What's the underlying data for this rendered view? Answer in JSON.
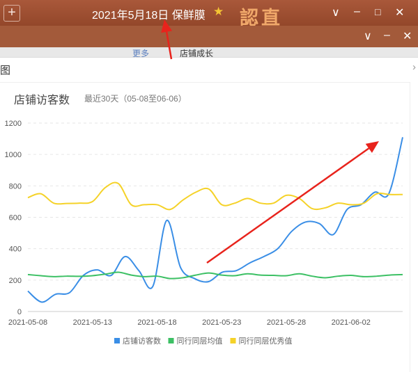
{
  "topbar": {
    "plus": "+",
    "title": "2021年5月18日 保鲜膜",
    "star_icon": "star-icon",
    "stamp_text": "認直",
    "minimize": "–",
    "maximize": "□",
    "close": "✕",
    "dropdown": "∨"
  },
  "secondbar": {
    "dropdown": "∨",
    "minimize": "–",
    "close": "✕"
  },
  "tabs": [
    "更多",
    "店铺成长"
  ],
  "dialog": {
    "title": "图",
    "close": "›"
  },
  "chart_data": {
    "type": "line",
    "title": "店铺访客数",
    "subtitle": "最近30天（05-08至06-06）",
    "xlabel": "",
    "ylabel": "",
    "ylim": [
      0,
      1200
    ],
    "yticks": [
      0,
      200,
      400,
      600,
      800,
      1000,
      1200
    ],
    "x": [
      "2021-05-08",
      "2021-05-09",
      "2021-05-10",
      "2021-05-11",
      "2021-05-12",
      "2021-05-13",
      "2021-05-14",
      "2021-05-15",
      "2021-05-16",
      "2021-05-17",
      "2021-05-18",
      "2021-05-19",
      "2021-05-20",
      "2021-05-21",
      "2021-05-22",
      "2021-05-23",
      "2021-05-24",
      "2021-05-25",
      "2021-05-26",
      "2021-05-27",
      "2021-05-28",
      "2021-05-29",
      "2021-05-30",
      "2021-05-31",
      "2021-06-01",
      "2021-06-02",
      "2021-06-03",
      "2021-06-04",
      "2021-06-05",
      "2021-06-06"
    ],
    "xtick_labels": [
      "2021-05-08",
      "2021-05-13",
      "2021-05-18",
      "2021-05-23",
      "2021-05-28",
      "2021-06-02"
    ],
    "grid": true,
    "legend_position": "bottom",
    "series": [
      {
        "name": "店铺访客数",
        "color": "#3a8ee6",
        "values": [
          130,
          60,
          110,
          120,
          230,
          265,
          230,
          350,
          260,
          160,
          580,
          280,
          210,
          190,
          250,
          260,
          310,
          350,
          400,
          510,
          570,
          560,
          490,
          650,
          680,
          760,
          750,
          1110
        ]
      },
      {
        "name": "同行同层均值",
        "color": "#3cc064",
        "values": [
          235,
          228,
          222,
          225,
          224,
          228,
          238,
          250,
          232,
          222,
          225,
          210,
          215,
          232,
          245,
          232,
          228,
          240,
          232,
          230,
          228,
          240,
          225,
          215,
          225,
          230,
          222,
          225,
          232,
          235
        ]
      },
      {
        "name": "同行同层优秀值",
        "color": "#f5d228",
        "values": [
          725,
          750,
          690,
          688,
          690,
          700,
          790,
          815,
          680,
          680,
          680,
          650,
          710,
          760,
          780,
          680,
          690,
          720,
          690,
          690,
          740,
          720,
          655,
          660,
          690,
          680,
          690,
          750,
          745,
          745
        ]
      }
    ]
  }
}
